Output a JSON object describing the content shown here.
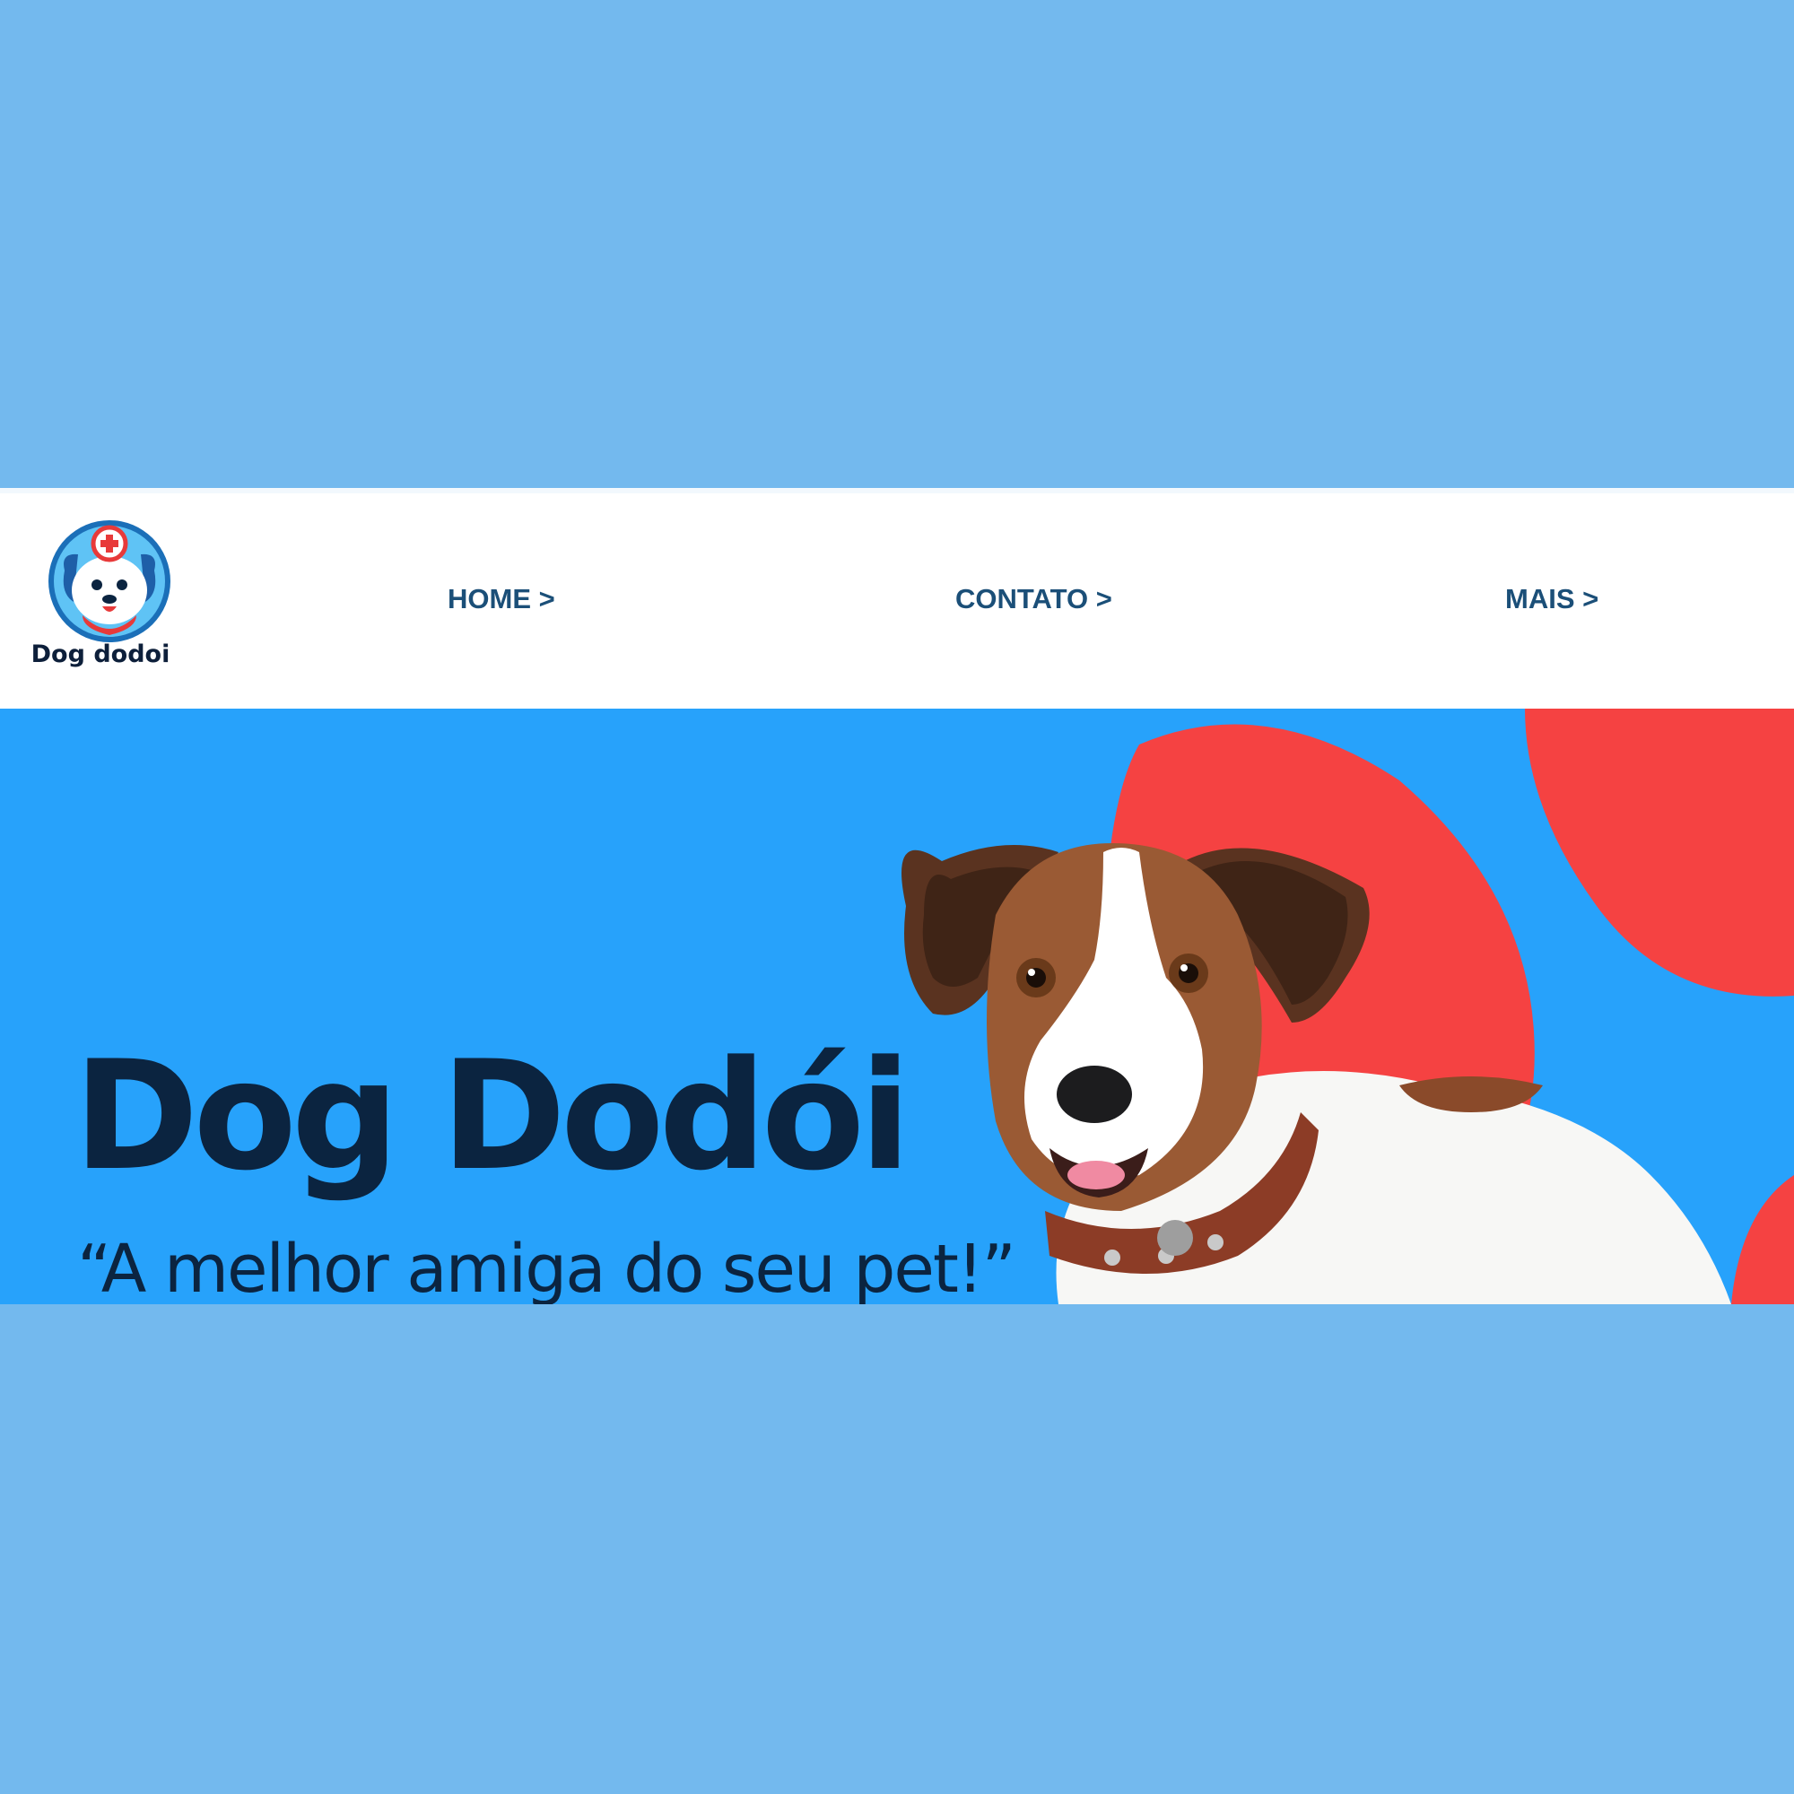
{
  "header": {
    "logo_text": "Dog dodoi",
    "nav": [
      {
        "label": "HOME >"
      },
      {
        "label": "CONTATO >"
      },
      {
        "label": "MAIS >"
      }
    ]
  },
  "hero": {
    "title": "Dog Dodói",
    "tagline": "“A melhor amiga do seu pet!”"
  },
  "colors": {
    "page_background": "#73b9ee",
    "hero_background": "#27a2fb",
    "accent_red": "#f54242",
    "title_navy": "#0b2440",
    "nav_blue": "#1b4f78"
  },
  "icons": {
    "logo": "dog-doctor-logo-icon",
    "hero_image": "jack-russell-terrier-dog-icon"
  }
}
